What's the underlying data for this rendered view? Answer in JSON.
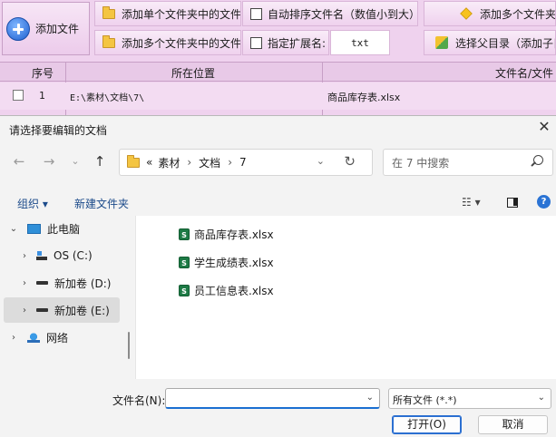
{
  "app": {
    "add_file_label": "添加文件",
    "btn_add_single_folder": "添加单个文件夹中的文件",
    "btn_add_multi_folder": "添加多个文件夹中的文件",
    "chk_auto_sort": "自动排序文件名（数值小到大）",
    "chk_ext": "指定扩展名:",
    "ext_value": "txt",
    "btn_add_multi_files": "添加多个文件夹",
    "btn_select_parent": "选择父目录（添加子目",
    "columns": [
      "序号",
      "所在位置",
      "文件名/文件"
    ],
    "rows": [
      {
        "num": "1",
        "location": "E:\\素材\\文档\\7\\",
        "filename": "商品库存表.xlsx"
      }
    ]
  },
  "dialog": {
    "title": "请选择要编辑的文档",
    "breadcrumb_prefix": "«",
    "breadcrumb": [
      "素材",
      "文档",
      "7"
    ],
    "search_placeholder": "在 7 中搜索",
    "organize_label": "组织 ▾",
    "new_folder_label": "新建文件夹",
    "view_label": "☷ ▾",
    "help_label": "?",
    "tree": [
      {
        "label": "此电脑",
        "arrow": "⌄",
        "icon": "pc-icon"
      },
      {
        "label": "OS (C:)",
        "arrow": "›",
        "icon": "os-drive-icon"
      },
      {
        "label": "新加卷 (D:)",
        "arrow": "›",
        "icon": "drive-icon"
      },
      {
        "label": "新加卷 (E:)",
        "arrow": "›",
        "icon": "drive-icon"
      },
      {
        "label": "网络",
        "arrow": "›",
        "icon": "network-icon"
      }
    ],
    "files": [
      "商品库存表.xlsx",
      "学生成绩表.xlsx",
      "员工信息表.xlsx"
    ],
    "filename_label": "文件名(N):",
    "filename_value": "",
    "filetype_value": "所有文件 (*.*)",
    "open_label": "打开(O)",
    "cancel_label": "取消"
  }
}
